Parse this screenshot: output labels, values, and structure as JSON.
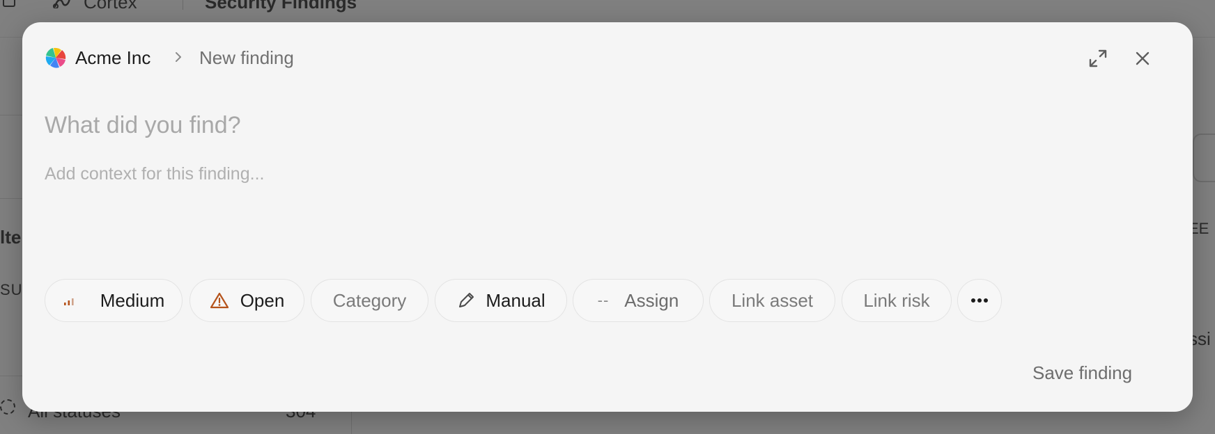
{
  "background": {
    "app_name": "Cortex",
    "page_title": "Security Findings",
    "sidebar_fragments": [
      "lte",
      "SU",
      "All statuses",
      "304"
    ],
    "right_fragments": [
      "EE",
      "ssi"
    ]
  },
  "modal": {
    "breadcrumb": {
      "org_name": "Acme Inc",
      "separator_icon": "chevron-right-icon",
      "page_name": "New finding"
    },
    "actions": {
      "expand_icon": "expand-icon",
      "close_icon": "close-icon"
    },
    "title_field": {
      "value": "",
      "placeholder": "What did you find?"
    },
    "description_field": {
      "value": "",
      "placeholder": "Add context for this finding..."
    },
    "properties": {
      "severity": {
        "label": "Medium",
        "icon": "signal-bars-icon",
        "color": "#b5531b"
      },
      "status": {
        "label": "Open",
        "icon": "warning-triangle-icon",
        "color": "#b5531b"
      },
      "category": {
        "label": "Category"
      },
      "source": {
        "label": "Manual",
        "icon": "pencil-icon"
      },
      "assignee": {
        "dash": "--",
        "label": "Assign"
      },
      "link_asset": {
        "label": "Link asset"
      },
      "link_risk": {
        "label": "Link risk"
      },
      "more": {
        "icon": "more-horizontal-icon"
      }
    },
    "save_label": "Save finding"
  }
}
